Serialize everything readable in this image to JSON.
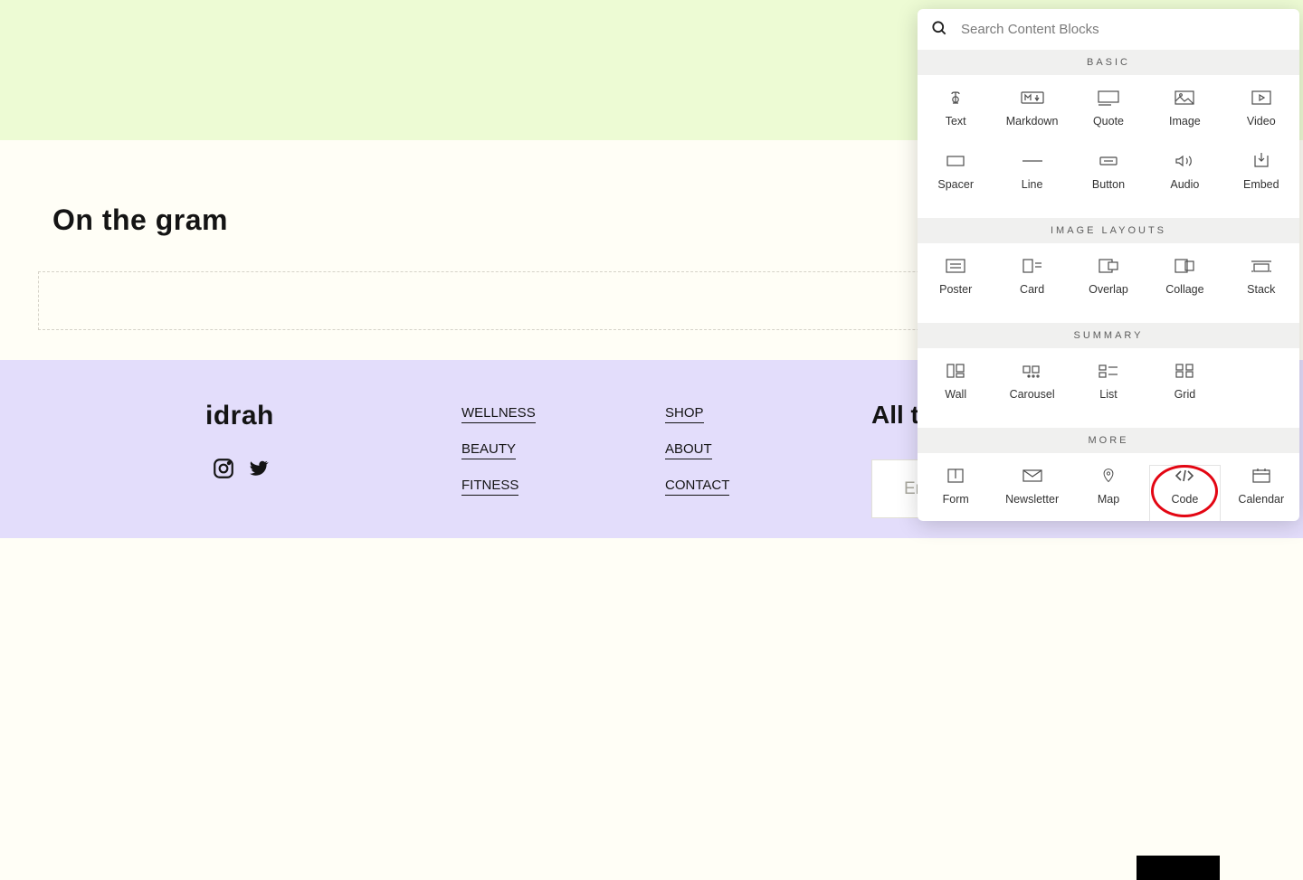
{
  "hero": {},
  "gram": {
    "heading": "On the gram"
  },
  "footer": {
    "brand": "idrah",
    "nav1": [
      "WELLNESS",
      "BEAUTY",
      "FITNESS"
    ],
    "nav2": [
      "SHOP",
      "ABOUT",
      "CONTACT"
    ],
    "newsletter_heading": "All th",
    "email_placeholder": "Em"
  },
  "panel": {
    "search_placeholder": "Search Content Blocks",
    "groups": [
      {
        "title": "BASIC",
        "items": [
          {
            "label": "Text",
            "icon": "text"
          },
          {
            "label": "Markdown",
            "icon": "markdown"
          },
          {
            "label": "Quote",
            "icon": "quote"
          },
          {
            "label": "Image",
            "icon": "image"
          },
          {
            "label": "Video",
            "icon": "video"
          },
          {
            "label": "Spacer",
            "icon": "spacer"
          },
          {
            "label": "Line",
            "icon": "line"
          },
          {
            "label": "Button",
            "icon": "button"
          },
          {
            "label": "Audio",
            "icon": "audio"
          },
          {
            "label": "Embed",
            "icon": "embed"
          }
        ]
      },
      {
        "title": "IMAGE LAYOUTS",
        "items": [
          {
            "label": "Poster",
            "icon": "poster"
          },
          {
            "label": "Card",
            "icon": "card"
          },
          {
            "label": "Overlap",
            "icon": "overlap"
          },
          {
            "label": "Collage",
            "icon": "collage"
          },
          {
            "label": "Stack",
            "icon": "stack"
          }
        ]
      },
      {
        "title": "SUMMARY",
        "items": [
          {
            "label": "Wall",
            "icon": "wall"
          },
          {
            "label": "Carousel",
            "icon": "carousel"
          },
          {
            "label": "List",
            "icon": "list"
          },
          {
            "label": "Grid",
            "icon": "grid"
          }
        ]
      },
      {
        "title": "MORE",
        "items": [
          {
            "label": "Form",
            "icon": "form"
          },
          {
            "label": "Newsletter",
            "icon": "newsletter"
          },
          {
            "label": "Map",
            "icon": "map"
          },
          {
            "label": "Code",
            "icon": "code",
            "highlight": true,
            "boxed": true
          },
          {
            "label": "Calendar",
            "icon": "calendar"
          }
        ]
      }
    ]
  }
}
